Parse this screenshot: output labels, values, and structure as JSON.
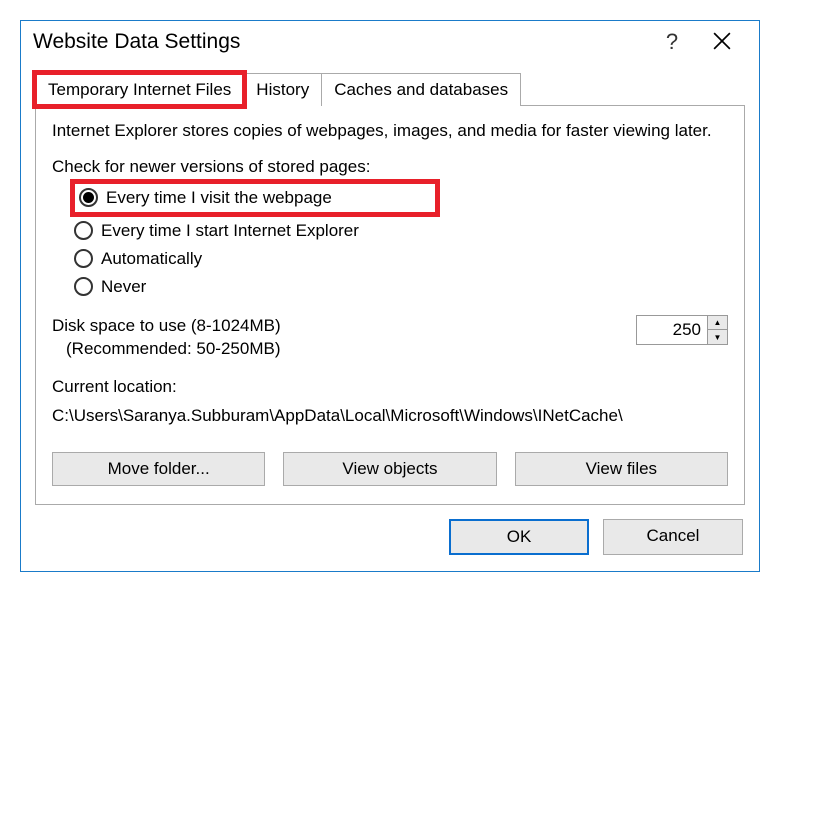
{
  "titlebar": {
    "title": "Website Data Settings",
    "help_glyph": "?",
    "close_label": "Close"
  },
  "tabs": {
    "0": {
      "label": "Temporary Internet Files"
    },
    "1": {
      "label": "History"
    },
    "2": {
      "label": "Caches and databases"
    }
  },
  "panel": {
    "description": "Internet Explorer stores copies of webpages, images, and media for faster viewing later.",
    "check_label": "Check for newer versions of stored pages:",
    "options": {
      "0": "Every time I visit the webpage",
      "1": "Every time I start Internet Explorer",
      "2": "Automatically",
      "3": "Never"
    },
    "disk": {
      "label_line1": "Disk space to use (8-1024MB)",
      "label_line2": "(Recommended: 50-250MB)",
      "value": "250"
    },
    "current_location_label": "Current location:",
    "current_location_path": "C:\\Users\\Saranya.Subburam\\AppData\\Local\\Microsoft\\Windows\\INetCache\\",
    "buttons": {
      "move": "Move folder...",
      "view_objects": "View objects",
      "view_files": "View files"
    }
  },
  "footer": {
    "ok": "OK",
    "cancel": "Cancel"
  }
}
